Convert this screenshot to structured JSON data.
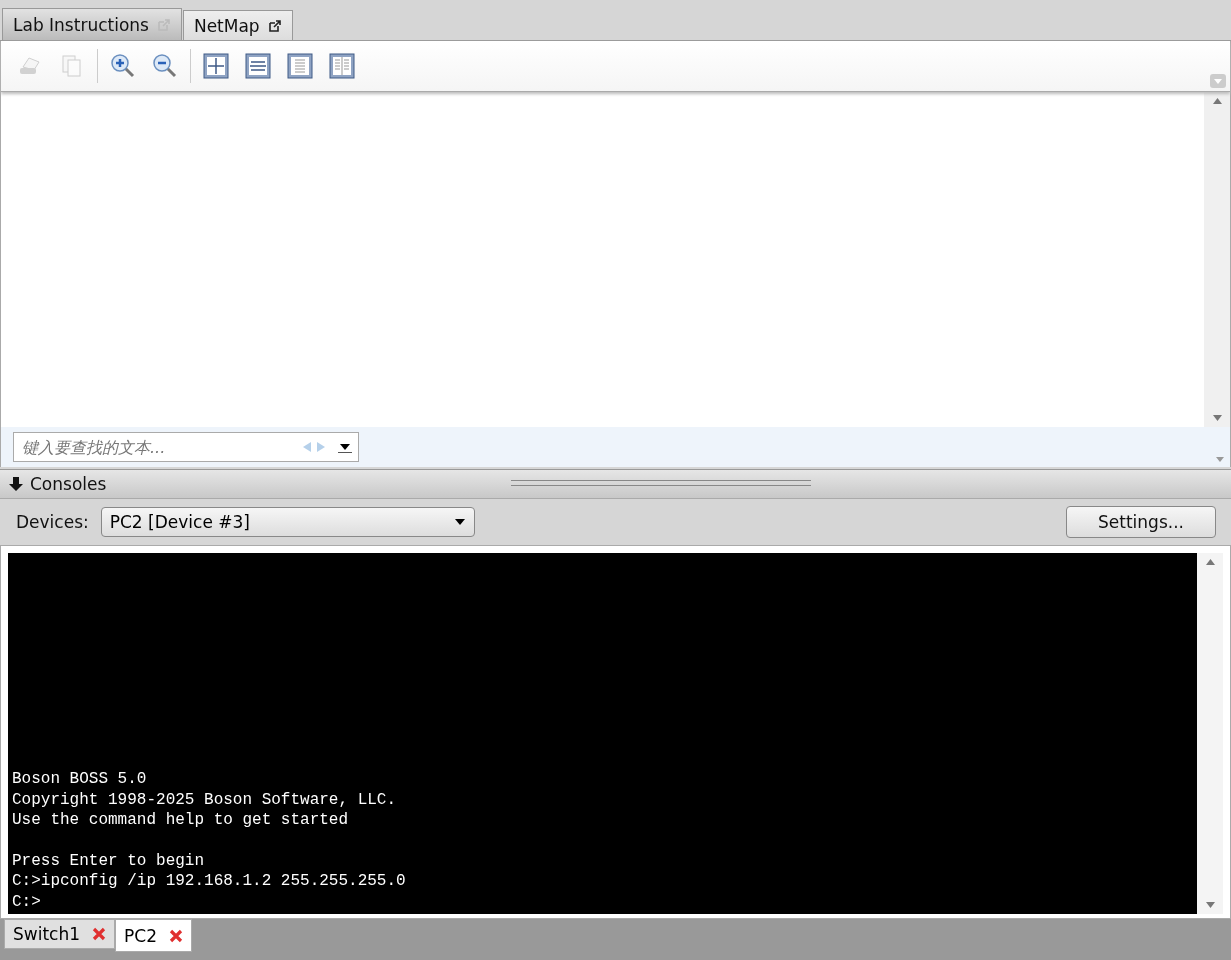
{
  "doc_tabs": [
    {
      "label": "Lab Instructions",
      "selected": true
    },
    {
      "label": "NetMap",
      "selected": false
    }
  ],
  "toolbar": [
    {
      "kind": "print",
      "disabled": true
    },
    {
      "kind": "copy",
      "disabled": true
    },
    {
      "kind": "zoom-in",
      "disabled": false
    },
    {
      "kind": "zoom-out",
      "disabled": false
    },
    {
      "kind": "fit-page",
      "disabled": false
    },
    {
      "kind": "fit-width",
      "disabled": false
    },
    {
      "kind": "single-page",
      "disabled": false
    },
    {
      "kind": "two-pages",
      "disabled": false
    }
  ],
  "search": {
    "placeholder": "键入要查找的文本..."
  },
  "consoles": {
    "title": "Consoles",
    "devices_label": "Devices:",
    "device": "PC2 [Device #3]",
    "settings_button": "Settings...",
    "terminal_blocks": [
      [
        "Boson BOSS 5.0",
        "Copyright 1998-2025 Boson Software, LLC.",
        "Use the command help to get started"
      ],
      [
        "Press Enter to begin",
        "C:>ipconfig /ip 192.168.1.2 255.255.255.0",
        "C:>"
      ]
    ]
  },
  "console_tabs": [
    {
      "label": "Switch1",
      "selected": false
    },
    {
      "label": "PC2",
      "selected": true
    }
  ]
}
